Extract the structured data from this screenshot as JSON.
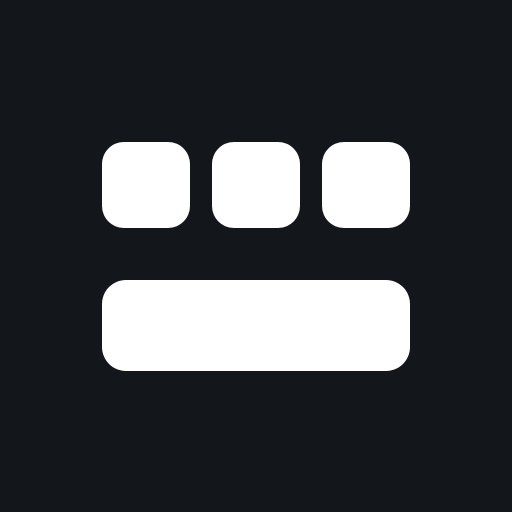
{
  "icon": {
    "glyph_name": "keyboard-icon",
    "colors": {
      "background": "#13171b",
      "foreground": "#ffffff"
    },
    "top_row_key_count": 3,
    "bottom_row_key_count": 1
  }
}
